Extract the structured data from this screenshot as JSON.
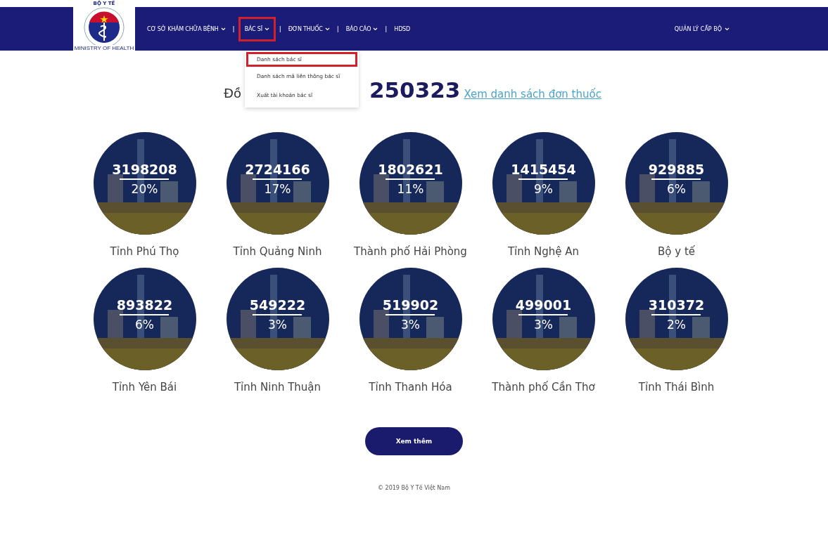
{
  "logo": {
    "top_text": "BỘ Y TẾ",
    "bottom_text": "MINISTRY OF HEALTH"
  },
  "nav": [
    {
      "label": "CƠ SỞ KHÁM CHỮA BỆNH",
      "dropdown": true,
      "highlighted": false
    },
    {
      "separator": "|",
      "label": "BÁC SĨ",
      "dropdown": true,
      "highlighted": true
    },
    {
      "separator": "|",
      "label": "ĐƠN THUỐC",
      "dropdown": true,
      "highlighted": false
    },
    {
      "separator": "|",
      "label": "BÁO CÁO",
      "dropdown": true,
      "highlighted": false
    },
    {
      "separator": "|",
      "label": "HDSD",
      "dropdown": false,
      "highlighted": false
    }
  ],
  "user_menu": {
    "label": "QUẢN LÝ CẤP BỘ"
  },
  "dropdown_menu": [
    {
      "label": "Danh sách bác sĩ",
      "highlighted": true
    },
    {
      "label": "Danh sách mã liên thông bác sĩ",
      "highlighted": false
    },
    {
      "label": "Xuất tài khoản bác sĩ",
      "highlighted": false
    }
  ],
  "heading": {
    "prefix": "Đồ",
    "number": "250323",
    "link": "Xem danh sách đơn thuốc"
  },
  "stats": [
    {
      "count": "3198208",
      "percent": "20%",
      "name": "Tỉnh Phú Thọ"
    },
    {
      "count": "2724166",
      "percent": "17%",
      "name": "Tỉnh Quảng Ninh"
    },
    {
      "count": "1802621",
      "percent": "11%",
      "name": "Thành phố Hải Phòng"
    },
    {
      "count": "1415454",
      "percent": "9%",
      "name": "Tỉnh Nghệ An"
    },
    {
      "count": "929885",
      "percent": "6%",
      "name": "Bộ y tế"
    },
    {
      "count": "893822",
      "percent": "6%",
      "name": "Tỉnh Yên Bái"
    },
    {
      "count": "549222",
      "percent": "3%",
      "name": "Tỉnh Ninh Thuận"
    },
    {
      "count": "519902",
      "percent": "3%",
      "name": "Tỉnh Thanh Hóa"
    },
    {
      "count": "499001",
      "percent": "3%",
      "name": "Thành phố Cần Thơ"
    },
    {
      "count": "310372",
      "percent": "2%",
      "name": "Tỉnh Thái Bình"
    }
  ],
  "more_button": "Xem thêm",
  "footer": "© 2019 Bộ Y Tế Việt Nam"
}
